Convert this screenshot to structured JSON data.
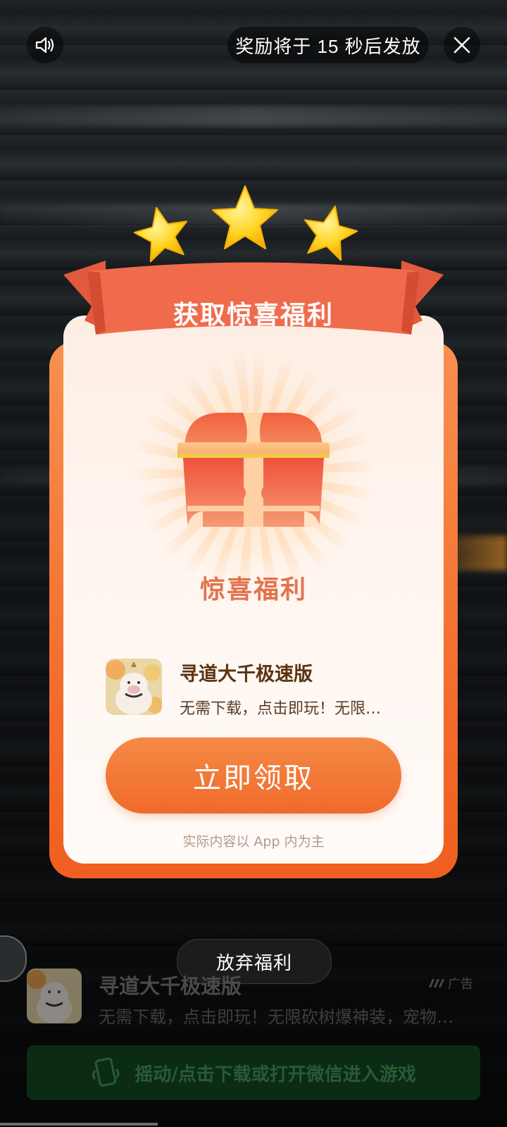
{
  "top": {
    "countdown_text": "奖励将于 15 秒后发放"
  },
  "card": {
    "ribbon_title": "获取惊喜福利",
    "reward_title": "惊喜福利",
    "app_name": "寻道大千极速版",
    "app_desc": "无需下载，点击即玩！无限…",
    "claim_label": "立即领取",
    "disclaimer": "实际内容以 App 内为主"
  },
  "bottom": {
    "abandon_label": "放弃福利",
    "app_name": "寻道大千极速版",
    "ad_label": "广告",
    "app_desc": "无需下载，点击即玩！无限砍树爆神装，宠物…",
    "download_label": "摇动/点击下载或打开微信进入游戏"
  },
  "colors": {
    "accent_orange": "#f26a2c",
    "ribbon_red": "#ef6a4c",
    "reward_title": "#e2734f",
    "star_yellow": "#ffd21f"
  },
  "icons": [
    "speaker-icon",
    "close-icon",
    "star-icon",
    "treasure-chest-icon",
    "ad-logo-icon",
    "phone-shake-icon"
  ]
}
